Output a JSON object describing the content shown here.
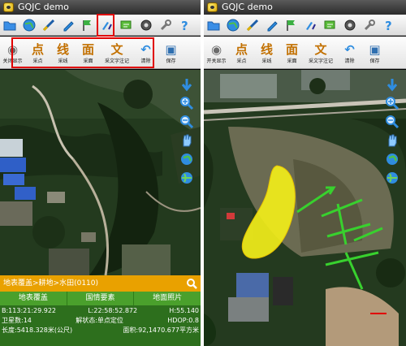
{
  "app": {
    "title": "GQJC demo"
  },
  "toolbar_left": {
    "tools": [
      {
        "icon": "eye-icon",
        "glyph": "◉",
        "label": "关闭显示"
      },
      {
        "icon": "collect-point-icon",
        "glyph": "点",
        "label": "采点"
      },
      {
        "icon": "collect-line-icon",
        "glyph": "线",
        "label": "采线"
      },
      {
        "icon": "collect-area-icon",
        "glyph": "面",
        "label": "采面"
      },
      {
        "icon": "collect-text-icon",
        "glyph": "文",
        "label": "采文字注记"
      },
      {
        "icon": "clear-icon",
        "glyph": "↶",
        "label": "清除"
      },
      {
        "icon": "save-icon",
        "glyph": "▣",
        "label": "保存"
      }
    ]
  },
  "toolbar_right": {
    "tools": [
      {
        "icon": "eye-icon",
        "glyph": "◉",
        "label": "开关显示"
      },
      {
        "icon": "collect-point-icon",
        "glyph": "点",
        "label": "采点"
      },
      {
        "icon": "collect-line-icon",
        "glyph": "线",
        "label": "采线"
      },
      {
        "icon": "collect-area-icon",
        "glyph": "面",
        "label": "采面"
      },
      {
        "icon": "collect-text-icon",
        "glyph": "文",
        "label": "采文字注记"
      },
      {
        "icon": "clear-icon",
        "glyph": "↶",
        "label": "清除"
      },
      {
        "icon": "save-icon",
        "glyph": "▣",
        "label": "保存"
      }
    ]
  },
  "info_panel": {
    "breadcrumb": "地表覆盖>耕地>水田(0110)",
    "tabs": [
      "地表覆盖",
      "国情要素",
      "地面照片"
    ],
    "latitude": "B:113:21:29.922",
    "longitude": "L:22:58:52.872",
    "height": "H:55.140",
    "satellites": "卫星数:14",
    "solution": "解状态:单点定位",
    "hdop": "HDOP:0.8",
    "length": "长度:5418.328米(公尺)",
    "area": "面积:92,1470.677平方米"
  },
  "colors": {
    "highlight_red": "#e00000",
    "info_orange": "#e9a100",
    "info_green": "#4aa02c",
    "polygon_yellow": "#f2ee1a",
    "line_green": "#38d12e"
  }
}
